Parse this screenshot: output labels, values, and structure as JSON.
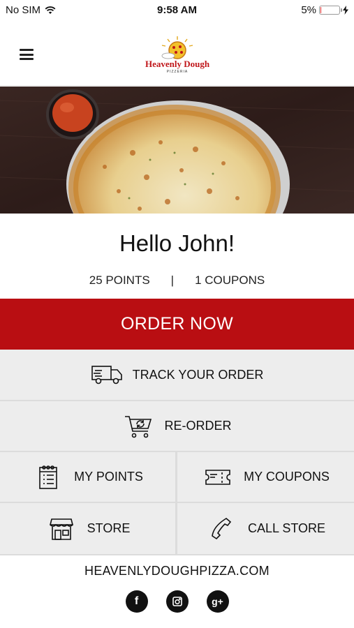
{
  "status_bar": {
    "carrier": "No SIM",
    "time": "9:58 AM",
    "battery_percent_label": "5%",
    "battery_level": 0.05
  },
  "header": {
    "menu_icon": "hamburger-menu-icon",
    "logo_text": "Heavenly Dough",
    "logo_subtext": "PIZZERIA"
  },
  "greeting": {
    "text": "Hello John!",
    "points": "25 POINTS",
    "separator": "|",
    "coupons": "1 COUPONS"
  },
  "actions": {
    "order_now": "ORDER NOW",
    "track_order": "TRACK YOUR ORDER",
    "reorder": "RE-ORDER",
    "my_points": "MY POINTS",
    "my_coupons": "MY COUPONS",
    "store": "STORE",
    "call_store": "CALL STORE"
  },
  "footer": {
    "website": "HEAVENLYDOUGHPIZZA.COM",
    "social": [
      {
        "icon": "facebook-icon",
        "glyph": "f"
      },
      {
        "icon": "instagram-icon",
        "glyph": ""
      },
      {
        "icon": "google-plus-icon",
        "glyph": "g+"
      }
    ]
  },
  "colors": {
    "accent": "#b90e12",
    "tile_background": "#ededed",
    "text": "#111111"
  }
}
